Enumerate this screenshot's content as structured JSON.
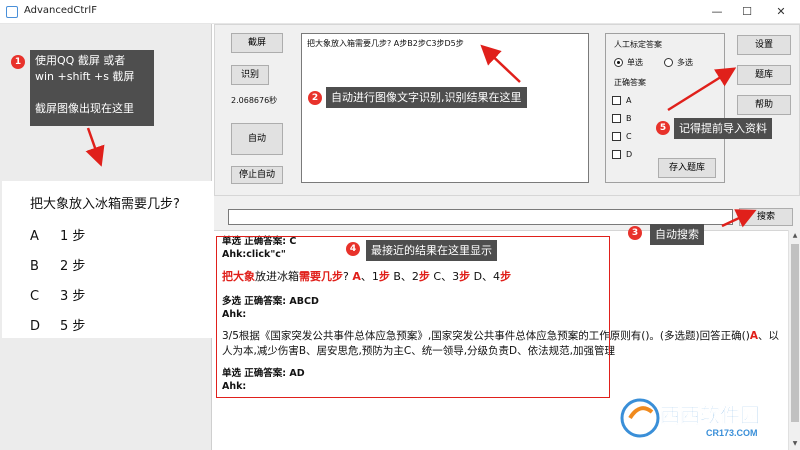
{
  "window": {
    "title": "AdvancedCtrlF",
    "min": "—",
    "max": "☐",
    "close": "✕"
  },
  "capture": {
    "question": "把大象放入冰箱需要几步?",
    "options": [
      {
        "letter": "A",
        "text": "1 步"
      },
      {
        "letter": "B",
        "text": "2 步"
      },
      {
        "letter": "C",
        "text": "3 步"
      },
      {
        "letter": "D",
        "text": "5 步"
      }
    ]
  },
  "buttons": {
    "screenshot": "截屏",
    "recognize": "识别",
    "auto": "自动",
    "stop_auto": "停止自动",
    "settings": "设置",
    "bank": "题库",
    "help": "帮助",
    "save_bank": "存入题库",
    "search": "搜索"
  },
  "elapsed": "2.068676秒",
  "ocr_result": "把大象放入箱需要几步? A步B2步C3步D5步",
  "manual_group": {
    "title": "人工标定答案",
    "single": "单选",
    "multi": "多选",
    "correct_label": "正确答案",
    "checks": [
      "A",
      "B",
      "C",
      "D"
    ]
  },
  "search": {
    "value": ""
  },
  "results": [
    {
      "type_line": "单选 正确答案: C",
      "ahk": "Ahk:click\"c\""
    },
    {
      "type_line": "多选 正确答案: ABCD",
      "ahk": "Ahk:",
      "text": "3/5根据《国家突发公共事件总体应急预案》,国家突发公共事件总体应急预案的工作原则有()。(多选题)回答正确()",
      "answer_text": "、以人为本,减少伤害B、居安思危,预防为主C、统一领导,分级负责D、依法规范,加强管理"
    },
    {
      "type_line": "单选 正确答案: AD",
      "ahk": "Ahk:"
    }
  ],
  "highlight_question": {
    "p1": "把大象",
    "p2": "放进冰箱",
    "p3": "需要几步",
    "p4": "? ",
    "p5": "A",
    "p6": "、1",
    "p7": "步",
    "p8": " B、2",
    "p9": "步",
    "p10": " C、3",
    "p11": "步",
    "p12": " D、4",
    "p13": "步"
  },
  "annotations": {
    "a1": "使用QQ 截屏 或者\nwin +shift +s 截屏\n\n截屏图像出现在这里",
    "a2": "自动进行图像文字识别,识别结果在这里",
    "a3": "自动搜索",
    "a4": "最接近的结果在这里显示",
    "a5": "记得提前导入资料",
    "n1": "1",
    "n2": "2",
    "n3": "3",
    "n4": "4",
    "n5": "5"
  },
  "watermark": {
    "brand": "西西软件园",
    "site": "CR173.COM"
  },
  "colors": {
    "accent_red": "#e0201b",
    "annotation_bg": "#4e4e4e"
  }
}
